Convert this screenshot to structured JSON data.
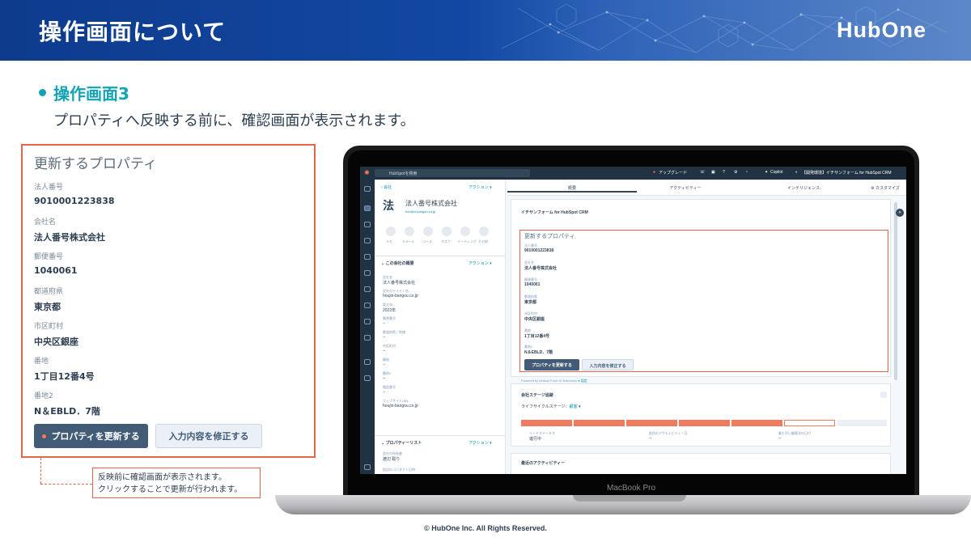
{
  "header": {
    "title": "操作画面について",
    "logo": "HubOne"
  },
  "section": {
    "heading": "操作画面3",
    "description": "プロパティへ反映する前に、確認画面が表示されます。"
  },
  "card": {
    "title": "更新するプロパティ",
    "fields": [
      {
        "label": "法人番号",
        "value": "9010001223838"
      },
      {
        "label": "会社名",
        "value": "法人番号株式会社"
      },
      {
        "label": "郵便番号",
        "value": "1040061"
      },
      {
        "label": "都道府県",
        "value": "東京都"
      },
      {
        "label": "市区町村",
        "value": "中央区銀座"
      },
      {
        "label": "番地",
        "value": "1丁目12番4号"
      },
      {
        "label": "番地2",
        "value": "N＆EBLD．7階"
      }
    ],
    "update_button": "プロパティを更新する",
    "fix_button": "入力内容を修正する"
  },
  "note": {
    "line1": "反映前に確認画面が表示されます。",
    "line2": "クリックすることで更新が行われます。"
  },
  "laptop": {
    "brand": "MacBook Pro"
  },
  "screen": {
    "topbar": {
      "search": "HubSpotを検索",
      "upgrade": "アップグレード",
      "copilot": "Copilot",
      "account": "【開発環境】イチサンフォーム for HubSpot CRM"
    },
    "left": {
      "back": "会社",
      "actions": "アクション",
      "avatar": "法",
      "company_name": "法人番号株式会社",
      "domain": "hou@n-bangou.co.jp",
      "quick_actions": [
        "メモ",
        "Eメール",
        "コール",
        "タスク",
        "ミーティング",
        "その他"
      ],
      "about_title": "この会社の概要",
      "about_fields": [
        {
          "label": "会社名",
          "value": "法人番号株式会社"
        },
        {
          "label": "会社のドメイン名",
          "value": "houjin-bangou.co.jp"
        },
        {
          "label": "設立年",
          "value": "2022年"
        },
        {
          "label": "郵便番号",
          "value": "--"
        },
        {
          "label": "都道府県／地域",
          "value": "--"
        },
        {
          "label": "市区町村",
          "value": "--"
        },
        {
          "label": "番地",
          "value": "--"
        },
        {
          "label": "番地2",
          "value": "--"
        },
        {
          "label": "電話番号",
          "value": "--"
        },
        {
          "label": "ウェブサイトURL",
          "value": "houjin-bangou.co.jp"
        }
      ],
      "props_title": "プロパティーリスト",
      "props_fields": [
        {
          "label": "会社の所有者",
          "value": "渡辺 聡り"
        },
        {
          "label": "前回のコンタクト日時",
          "value": ""
        }
      ]
    },
    "tabs": [
      "概要",
      "アクティビティー",
      "インテリジェンス"
    ],
    "customize": "カスタマイズ",
    "form": {
      "app_title": "イチサンフォーム for HubSpot CRM",
      "title": "更新するプロパティ",
      "fields": [
        {
          "label": "法人番号",
          "value": "9010001223838"
        },
        {
          "label": "会社名",
          "value": "法人番号株式会社"
        },
        {
          "label": "郵便番号",
          "value": "1040061"
        },
        {
          "label": "都道府県",
          "value": "東京都"
        },
        {
          "label": "市区町村",
          "value": "中央区銀座"
        },
        {
          "label": "番地",
          "value": "1丁目12番4号"
        },
        {
          "label": "番地2",
          "value": "N＆EBLD．7階"
        }
      ],
      "update_button": "プロパティを更新する",
      "fix_button": "入力内容を修正する",
      "powered": "Powered by Ichisan Form UI Extension",
      "verified": "認定"
    },
    "stage": {
      "title": "会社ステージ追跡",
      "lifecycle_label": "ライフサイクルステージ：",
      "lifecycle_value": "顧客",
      "cols": [
        {
          "label": "リードステータス",
          "value": "進行中"
        },
        {
          "label": "前回のアクティビティー日",
          "value": "--"
        },
        {
          "label": "最も早い顧客化の日付",
          "value": "--"
        }
      ]
    },
    "activity_title": "最近のアクティビティー"
  },
  "footer": "© HubOne Inc. All Rights Reserved."
}
